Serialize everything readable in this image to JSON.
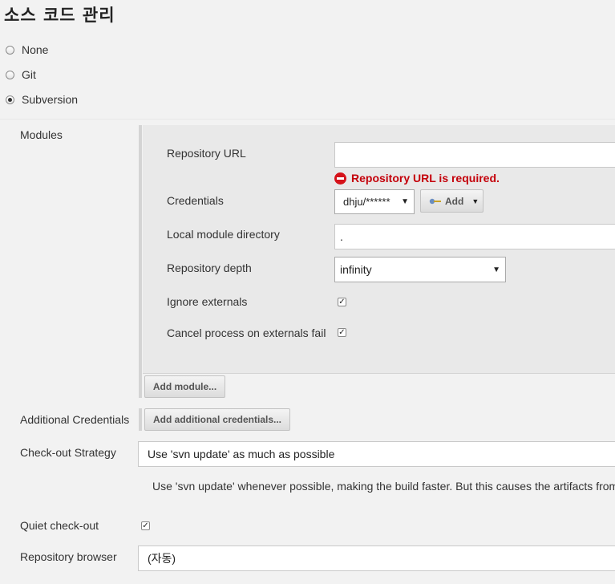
{
  "section_title": "소스 코드 관리",
  "scm_options": [
    {
      "label": "None",
      "selected": false
    },
    {
      "label": "Git",
      "selected": false
    },
    {
      "label": "Subversion",
      "selected": true
    }
  ],
  "modules": {
    "label": "Modules",
    "repository_url": {
      "label": "Repository URL",
      "value": "",
      "error": "Repository URL is required."
    },
    "credentials": {
      "label": "Credentials",
      "value": "dhju/******",
      "add_label": "Add"
    },
    "local_module_directory": {
      "label": "Local module directory",
      "value": "."
    },
    "repository_depth": {
      "label": "Repository depth",
      "value": "infinity"
    },
    "ignore_externals": {
      "label": "Ignore externals",
      "checked": true
    },
    "cancel_on_externals_fail": {
      "label": "Cancel process on externals fail",
      "checked": true
    },
    "add_module_label": "Add module..."
  },
  "additional_credentials": {
    "label": "Additional Credentials",
    "button_label": "Add additional credentials..."
  },
  "checkout_strategy": {
    "label": "Check-out Strategy",
    "value": "Use 'svn update' as much as possible",
    "help": "Use 'svn update' whenever possible, making the build faster. But this causes the artifacts from"
  },
  "quiet_checkout": {
    "label": "Quiet check-out",
    "checked": true
  },
  "repository_browser": {
    "label": "Repository browser",
    "value": "(자동)"
  },
  "colors": {
    "error": "#c4000a",
    "error_icon": "#d5121a",
    "background": "#f2f2f2",
    "module_panel": "#e9e9e9"
  }
}
